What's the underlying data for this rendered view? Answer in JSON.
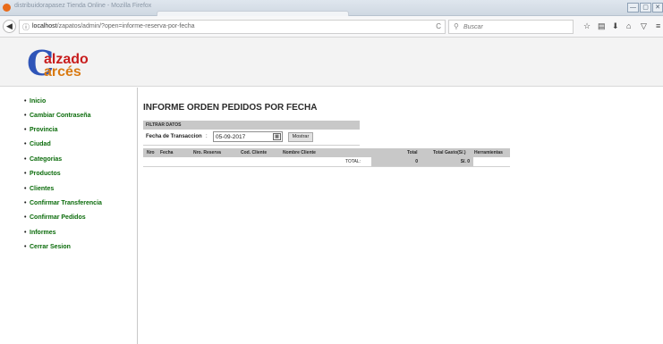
{
  "browser": {
    "window_title": "distribuidorapasez Tienda Online - Mozilla Firefox",
    "url_host": "localhost",
    "url_path": "/zapatos/admin/?open=informe-reserva-por-fecha",
    "search_placeholder": "Buscar"
  },
  "brand": {
    "logo_initial": "C",
    "logo_line1": "alzado",
    "logo_line2": "arcés"
  },
  "sidebar": {
    "items": [
      {
        "label": "Inicio"
      },
      {
        "label": "Cambiar Contraseña"
      },
      {
        "label": "Provincia"
      },
      {
        "label": "Ciudad"
      },
      {
        "label": "Categorias"
      },
      {
        "label": "Productos"
      },
      {
        "label": "Clientes"
      },
      {
        "label": "Confirmar Transferencia"
      },
      {
        "label": "Confirmar Pedidos"
      },
      {
        "label": "Informes"
      },
      {
        "label": "Cerrar Sesion"
      }
    ]
  },
  "report": {
    "title": "INFORME ORDEN PEDIDOS POR FECHA",
    "filter_header": "FILTRAR DATOS",
    "date_label": "Fecha de Transaccion",
    "date_value": "05-09-2017",
    "show_button": "Mostrar",
    "columns": [
      "Nro",
      "Fecha",
      "Nro. Reserva",
      "Cod. Cliente",
      "Nombre Cliente",
      "Total",
      "Total Gasto(S/.)",
      "Herramientas"
    ],
    "total_label": "TOTAL:",
    "total_value": "0",
    "total_spent_value": "S/. 0"
  },
  "colors": {
    "menu_green": "#0a6b0a",
    "logo_blue": "#2f55b8",
    "logo_red": "#c81d1d",
    "logo_orange": "#d97a12",
    "table_header_gray": "#c8c8c8"
  }
}
